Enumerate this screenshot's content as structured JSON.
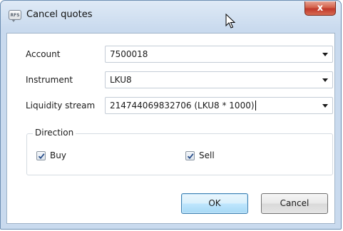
{
  "window": {
    "title": "Cancel quotes",
    "app_icon_text": "RFS",
    "close_glyph": "x"
  },
  "fields": {
    "account": {
      "label": "Account",
      "value": "7500018"
    },
    "instrument": {
      "label": "Instrument",
      "value": "LKU8"
    },
    "liquidity_stream": {
      "label": "Liquidity stream",
      "value": "214744069832706 (LKU8 * 1000)"
    }
  },
  "direction": {
    "title": "Direction",
    "buy": {
      "label": "Buy",
      "checked": true
    },
    "sell": {
      "label": "Sell",
      "checked": true
    }
  },
  "buttons": {
    "ok": "OK",
    "cancel": "Cancel"
  },
  "colors": {
    "titlebar": "#c9daee",
    "close_button": "#c0392b",
    "default_button_border": "#3c7fb1",
    "checkmark": "#2a4f8a"
  },
  "icons": {
    "app": "rfs-chat-bubble-icon",
    "close": "close-icon",
    "dropdown": "chevron-down-icon",
    "check": "checkmark-icon"
  }
}
